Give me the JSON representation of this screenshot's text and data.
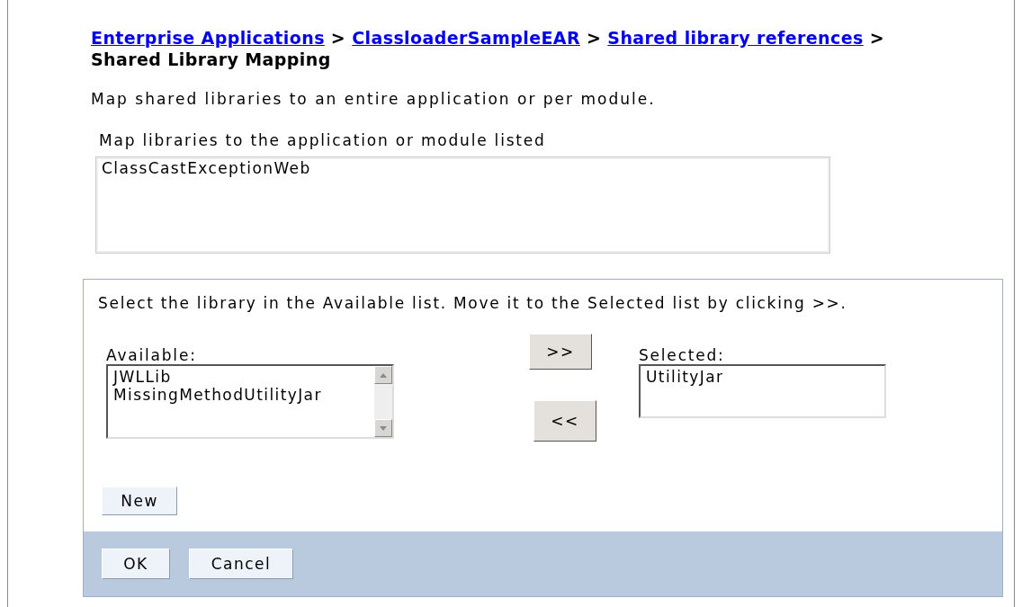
{
  "breadcrumb": {
    "separator": ">",
    "items": [
      {
        "label": "Enterprise Applications",
        "kind": "link"
      },
      {
        "label": "ClassloaderSampleEAR",
        "kind": "link"
      },
      {
        "label": "Shared library references",
        "kind": "link"
      },
      {
        "label": "Shared Library Mapping",
        "kind": "current"
      }
    ]
  },
  "description": "Map shared libraries to an entire application or per module.",
  "module_list": {
    "label": "Map libraries to the application or module listed",
    "items": [
      "ClassCastExceptionWeb"
    ]
  },
  "selector": {
    "instruction": "Select the library in the Available list. Move it to the Selected list by clicking >>.",
    "available": {
      "label": "Available:",
      "items": [
        "JWLLib",
        "MissingMethodUtilityJar"
      ]
    },
    "move_buttons": [
      ">>",
      "<<"
    ],
    "selected": {
      "label": "Selected:",
      "items": [
        "UtilityJar"
      ]
    },
    "new_button": "New"
  },
  "buttons": [
    "OK",
    "Cancel"
  ]
}
